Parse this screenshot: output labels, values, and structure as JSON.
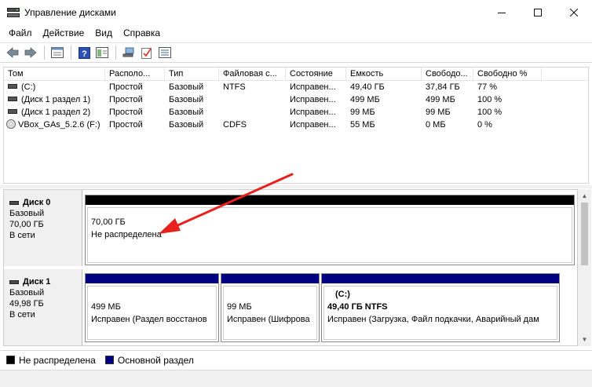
{
  "window": {
    "title": "Управление дисками"
  },
  "menu": [
    "Файл",
    "Действие",
    "Вид",
    "Справка"
  ],
  "volumes": {
    "columns": [
      "Том",
      "Располо...",
      "Тип",
      "Файловая с...",
      "Состояние",
      "Емкость",
      "Свободо...",
      "Свободно %"
    ],
    "rows": [
      {
        "name": "(C:)",
        "layout": "Простой",
        "type": "Базовый",
        "fs": "NTFS",
        "status": "Исправен...",
        "capacity": "49,40 ГБ",
        "free": "37,84 ГБ",
        "free_pct": "77 %"
      },
      {
        "name": "(Диск 1 раздел 1)",
        "layout": "Простой",
        "type": "Базовый",
        "fs": "",
        "status": "Исправен...",
        "capacity": "499 МБ",
        "free": "499 МБ",
        "free_pct": "100 %"
      },
      {
        "name": "(Диск 1 раздел 2)",
        "layout": "Простой",
        "type": "Базовый",
        "fs": "",
        "status": "Исправен...",
        "capacity": "99 МБ",
        "free": "99 МБ",
        "free_pct": "100 %"
      },
      {
        "name": "VBox_GAs_5.2.6 (F:)",
        "layout": "Простой",
        "type": "Базовый",
        "fs": "CDFS",
        "status": "Исправен...",
        "capacity": "55 МБ",
        "free": "0 МБ",
        "free_pct": "0 %"
      }
    ]
  },
  "disks": [
    {
      "name": "Диск 0",
      "type": "Базовый",
      "size": "70,00 ГБ",
      "state": "В сети",
      "partitions": [
        {
          "size": "70,00 ГБ",
          "status": "Не распределена"
        }
      ]
    },
    {
      "name": "Диск 1",
      "type": "Базовый",
      "size": "49,98 ГБ",
      "state": "В сети",
      "partitions": [
        {
          "label": "",
          "size": "499 МБ",
          "status": "Исправен (Раздел восстанов"
        },
        {
          "label": "",
          "size": "99 МБ",
          "status": "Исправен (Шифрова"
        },
        {
          "label": "(C:)",
          "size": "49,40 ГБ NTFS",
          "status": "Исправен (Загрузка, Файл подкачки, Аварийный дам"
        }
      ]
    }
  ],
  "legend": [
    "Не распределена",
    "Основной раздел"
  ],
  "colors": {
    "unallocated": "#000000",
    "primary": "#000080",
    "annotation_arrow": "#e8201e"
  },
  "icons": [
    "disk-management-icon",
    "back-icon",
    "forward-icon",
    "properties-icon",
    "help-icon",
    "console-tree-icon",
    "connect-icon",
    "check-icon",
    "list-icon",
    "minimize-icon",
    "maximize-icon",
    "close-icon"
  ]
}
